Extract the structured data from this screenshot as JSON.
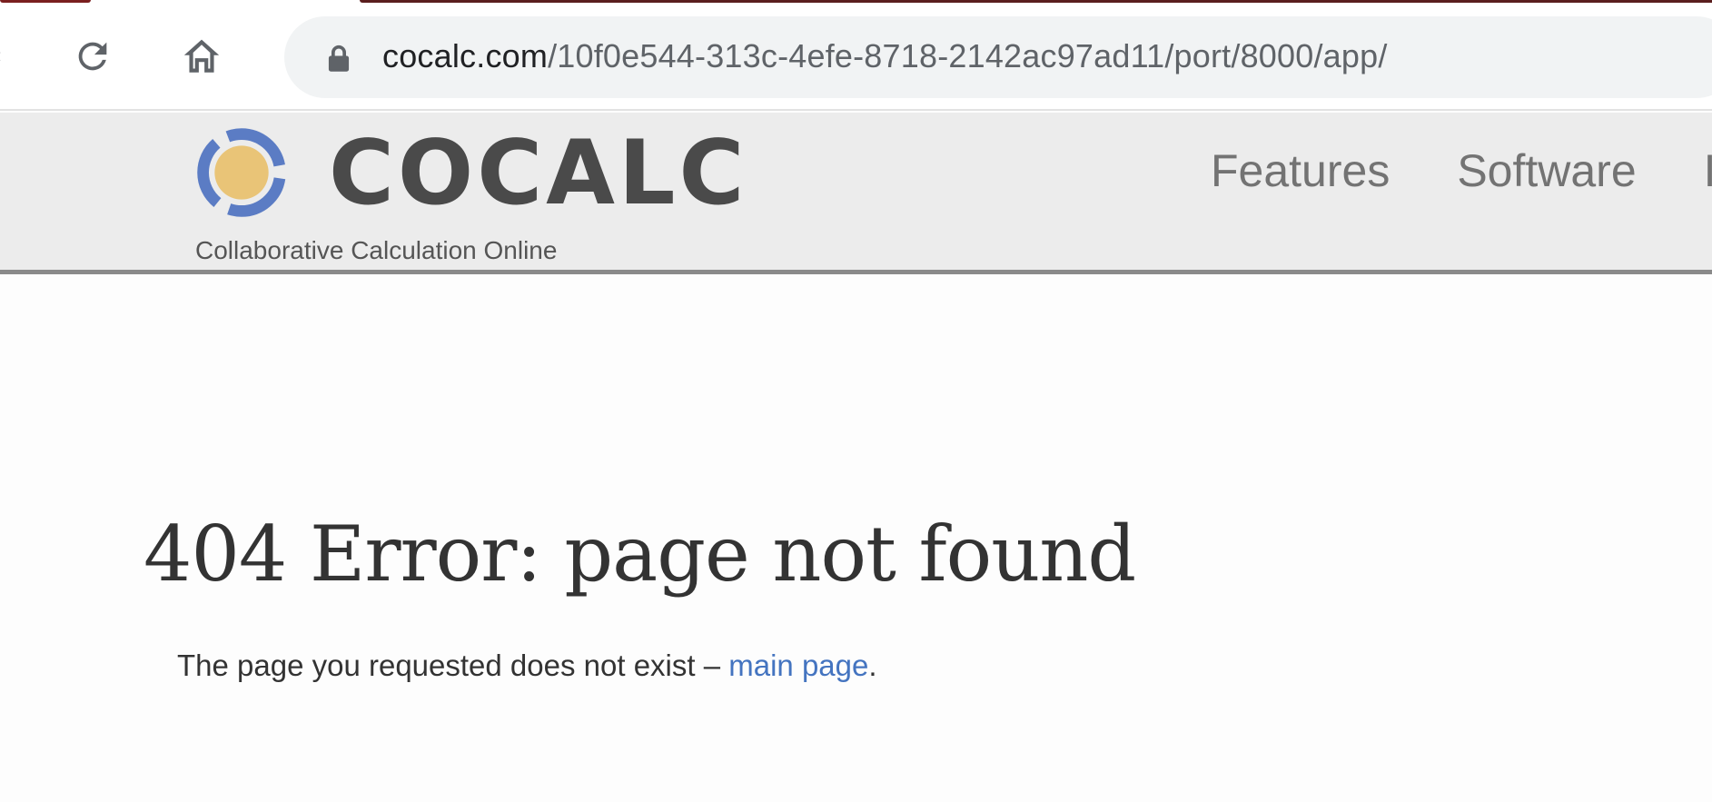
{
  "browser": {
    "back_hint": "‹",
    "url_host": "cocalc.com",
    "url_path": "/10f0e544-313c-4efe-8718-2142ac97ad11/port/8000/app/",
    "icons": [
      "reload-icon",
      "home-icon",
      "lock-icon"
    ]
  },
  "header": {
    "logo_text": "COCALC",
    "tagline": "Collaborative Calculation Online",
    "nav": [
      "Features",
      "Software",
      "I"
    ],
    "colors": {
      "logo_ring": "#5b7cc4",
      "logo_sun": "#e9c477",
      "header_bg": "#ececec"
    }
  },
  "main": {
    "title": "404 Error: page not found",
    "message_prefix": "The page you requested does not exist – ",
    "link_text": "main page",
    "message_suffix": ".",
    "colors": {
      "link": "#4474c0"
    }
  }
}
